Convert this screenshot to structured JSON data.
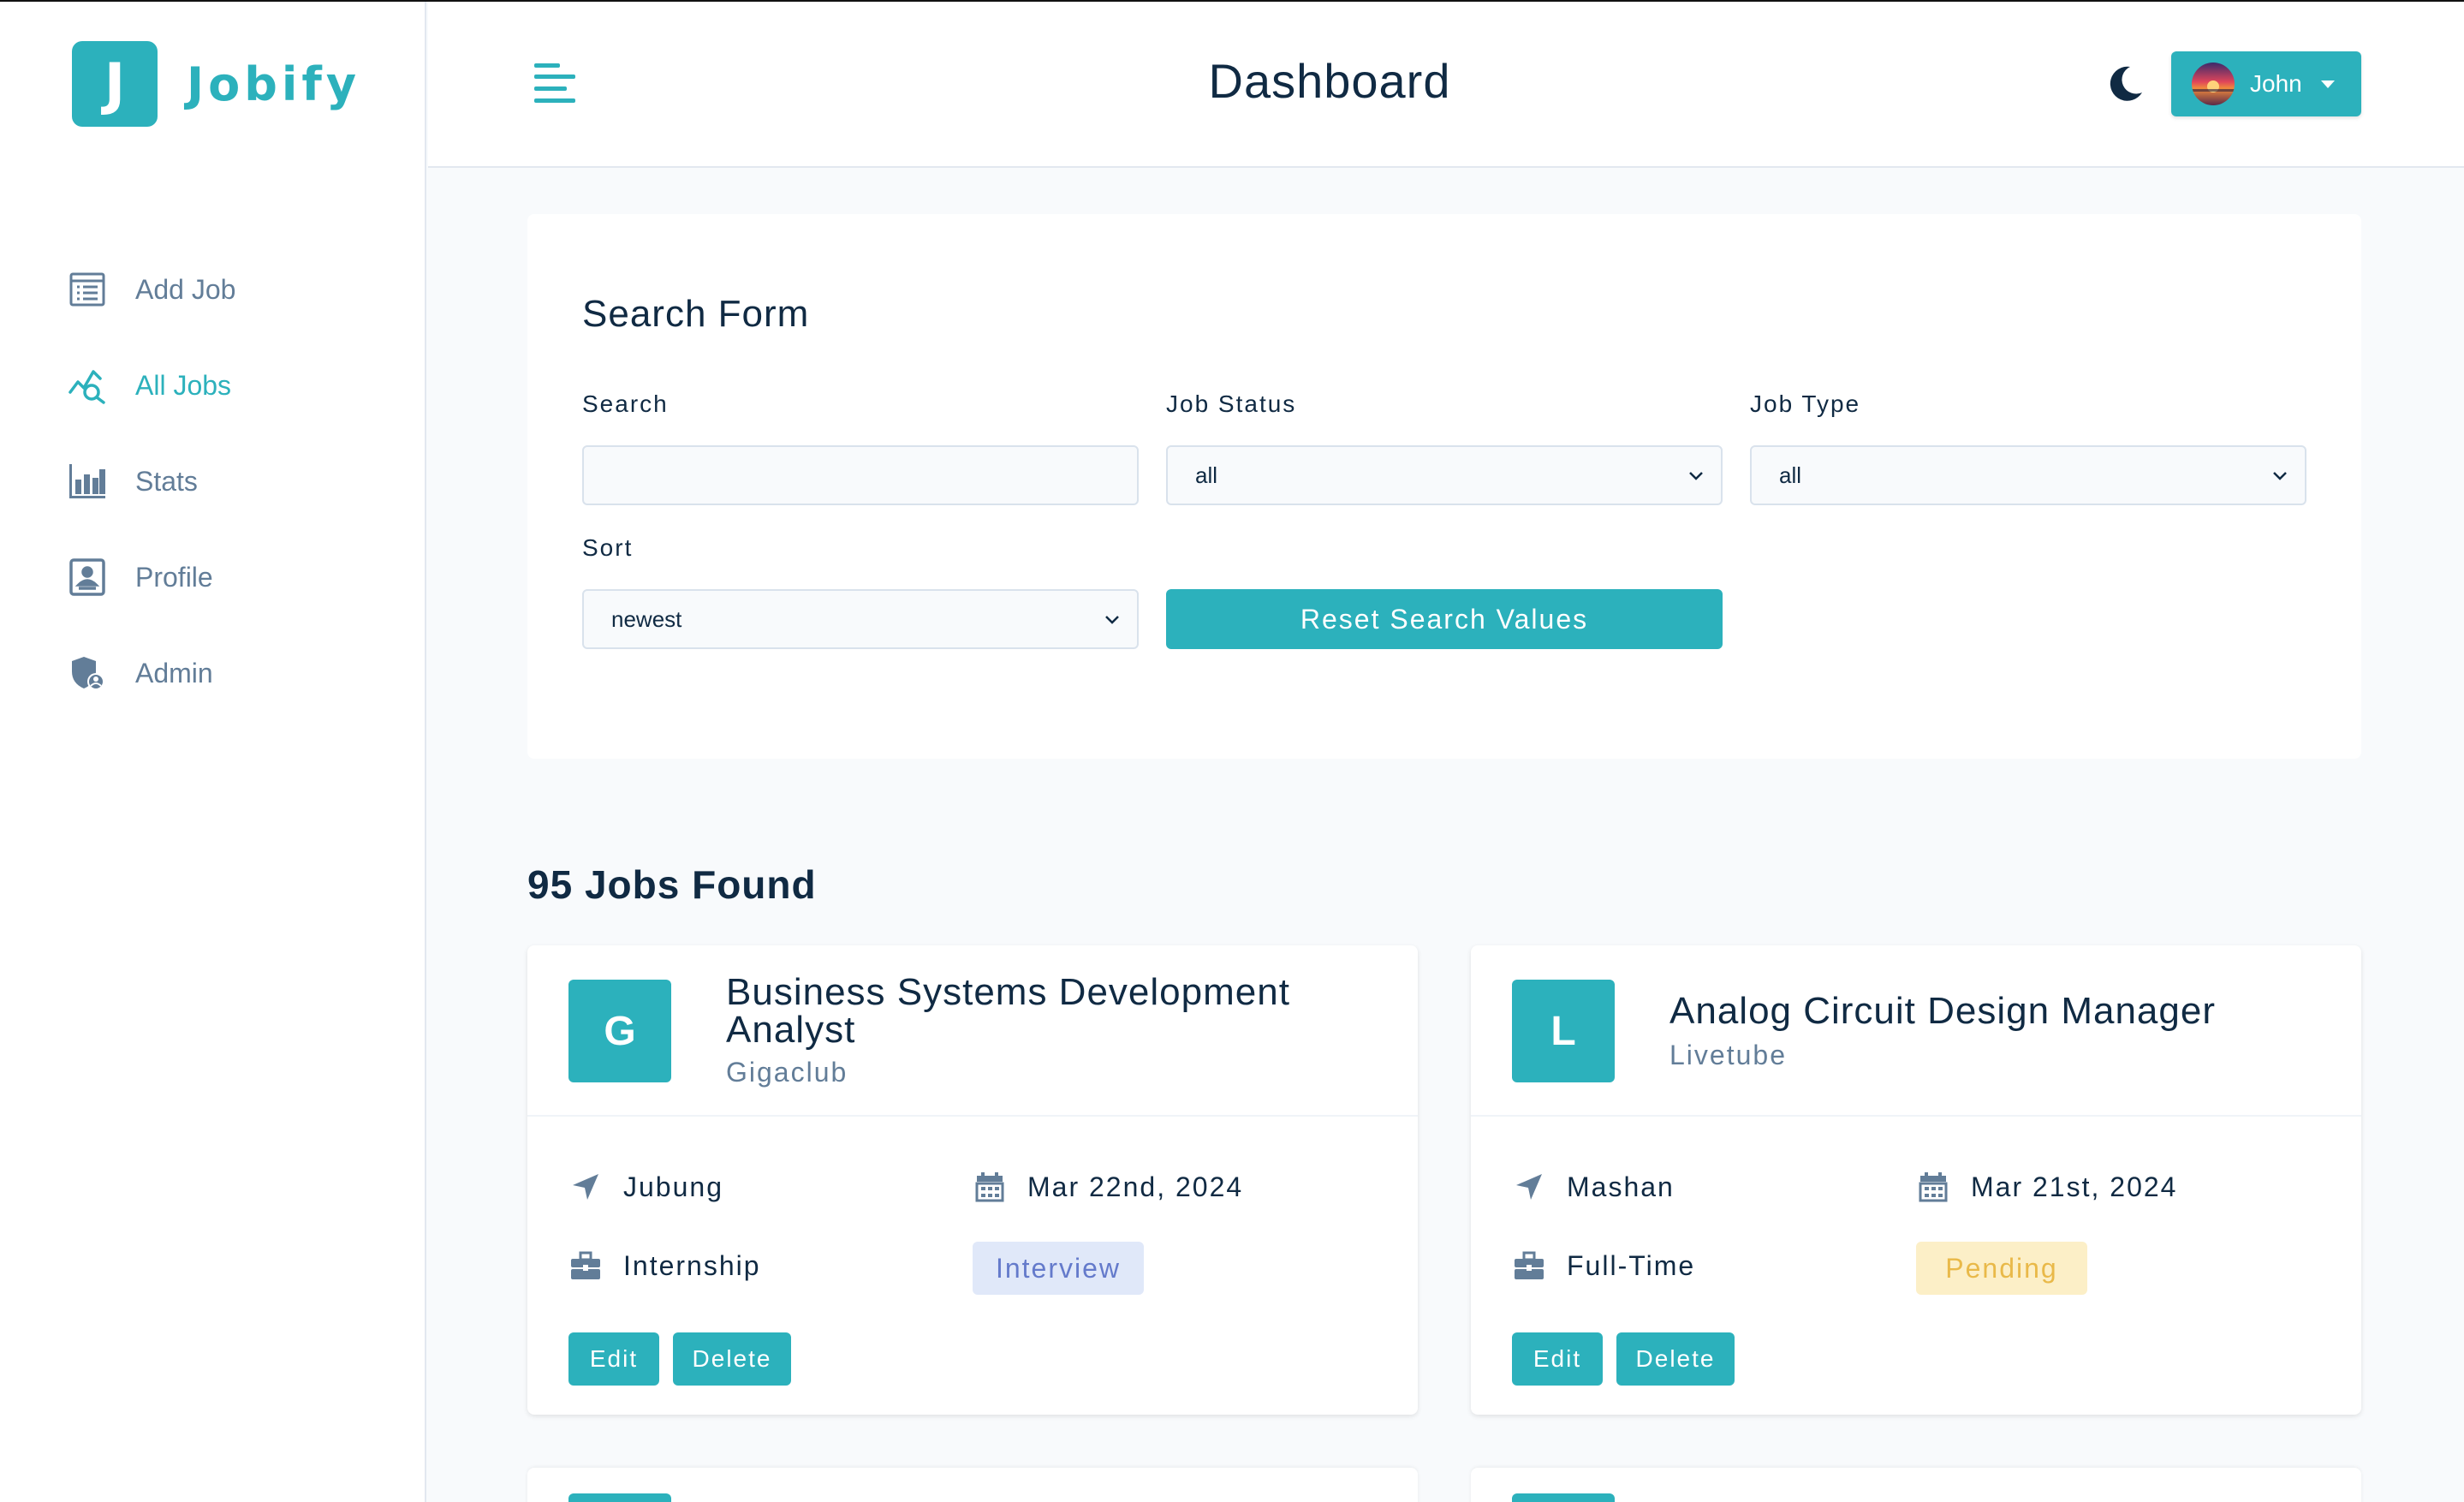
{
  "app": {
    "logo_letter": "J",
    "logo_name": "Jobify"
  },
  "sidebar": {
    "items": [
      {
        "label": "Add Job",
        "icon": "add-job-form-icon",
        "active": false
      },
      {
        "label": "All Jobs",
        "icon": "chart-search-icon",
        "active": true
      },
      {
        "label": "Stats",
        "icon": "bar-chart-icon",
        "active": false
      },
      {
        "label": "Profile",
        "icon": "id-card-icon",
        "active": false
      },
      {
        "label": "Admin",
        "icon": "shield-user-icon",
        "active": false
      }
    ]
  },
  "header": {
    "title": "Dashboard",
    "user_name": "John",
    "theme_icon": "moon-icon"
  },
  "search_form": {
    "title": "Search Form",
    "search_label": "Search",
    "search_value": "",
    "status_label": "Job Status",
    "status_value": "all",
    "type_label": "Job Type",
    "type_value": "all",
    "sort_label": "Sort",
    "sort_value": "newest",
    "reset_label": "Reset Search Values"
  },
  "jobs_found": "95 Jobs Found",
  "jobs": [
    {
      "letter": "G",
      "position_line1": "Business Systems Development",
      "position_line2": "Analyst",
      "company": "Gigaclub",
      "location": "Jubung",
      "date": "Mar 22nd, 2024",
      "type": "Internship",
      "status": "Interview",
      "edit": "Edit",
      "delete": "Delete"
    },
    {
      "letter": "L",
      "position_line1": "Analog Circuit Design Manager",
      "company": "Livetube",
      "location": "Mashan",
      "date": "Mar 21st, 2024",
      "type": "Full-Time",
      "status": "Pending",
      "edit": "Edit",
      "delete": "Delete"
    }
  ],
  "colors": {
    "primary": "#2cb1bc",
    "interview_bg": "#e0e8f9",
    "interview_text": "#647acb",
    "pending_bg": "#fcefc7",
    "pending_text": "#e9b949"
  }
}
